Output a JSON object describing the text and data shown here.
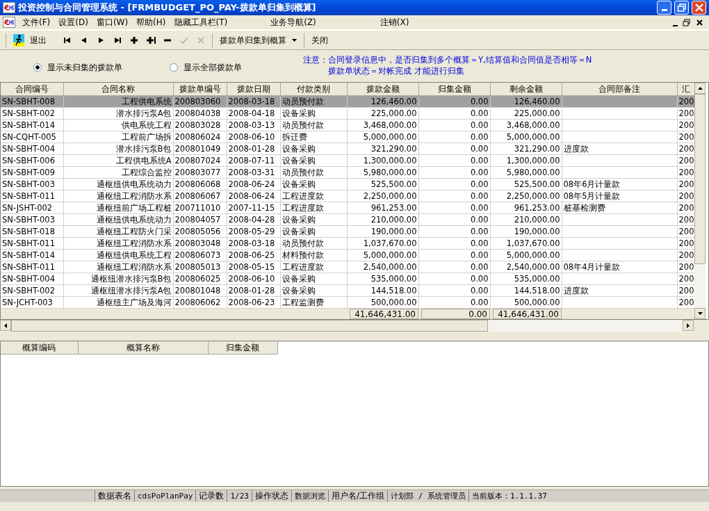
{
  "window": {
    "title": "投资控制与合同管理系统 - [FRMBUDGET_PO_PAY-拨款单归集到概算]"
  },
  "menu": [
    {
      "label": "文件(F)"
    },
    {
      "label": "设置(D)"
    },
    {
      "label": "窗口(W)"
    },
    {
      "label": "帮助(H)"
    },
    {
      "label": "隐藏工具栏(T)"
    },
    {
      "label": "业务导航(Z)"
    },
    {
      "label": "注销(X)"
    }
  ],
  "toolbar": [
    {
      "kind": "exit",
      "label": "退出"
    },
    {
      "kind": "first",
      "disabled": false
    },
    {
      "kind": "prev",
      "disabled": false
    },
    {
      "kind": "next",
      "disabled": false
    },
    {
      "kind": "last",
      "disabled": false
    },
    {
      "kind": "add",
      "disabled": false
    },
    {
      "kind": "insert",
      "disabled": false
    },
    {
      "kind": "delete",
      "disabled": false
    },
    {
      "kind": "confirm",
      "disabled": true
    },
    {
      "kind": "cancel",
      "disabled": true
    },
    {
      "kind": "dropdown",
      "label": "拨款单归集到概算"
    },
    {
      "kind": "button",
      "label": "关闭"
    }
  ],
  "filter": [
    {
      "label": "显示未归集的拨款单",
      "selected": true
    },
    {
      "label": "显示全部拨款单",
      "selected": false
    }
  ],
  "notice": [
    "注意：合同登录信息中，是否归集到多个概算＝Y,结算值和合同值是否相等＝N",
    "拨款单状态＝对帐完成 才能进行归集"
  ],
  "grid": {
    "columns": [
      "合同编号",
      "合同名称",
      "拨款单编号",
      "拨款日期",
      "付款类别",
      "拨款金额",
      "归集金额",
      "剩余金额",
      "合同部备注",
      "汇"
    ],
    "rows": [
      {
        "selected": true,
        "cells": [
          "SN-SBHT-008",
          "工程供电系统",
          "200803060",
          "2008-03-18",
          "动员预付款",
          "126,460.00",
          "0.00",
          "126,460.00",
          "",
          "200"
        ]
      },
      {
        "selected": false,
        "cells": [
          "SN-SBHT-002",
          "潜水排污泵A包",
          "200804038",
          "2008-04-18",
          "设备采购",
          "225,000.00",
          "0.00",
          "225,000.00",
          "",
          "200"
        ]
      },
      {
        "selected": false,
        "cells": [
          "SN-SBHT-014",
          "供电系统工程",
          "200803028",
          "2008-03-13",
          "动员预付款",
          "3,468,000.00",
          "0.00",
          "3,468,000.00",
          "",
          "200"
        ]
      },
      {
        "selected": false,
        "cells": [
          "SN-CQHT-005",
          "工程前广场拆",
          "200806024",
          "2008-06-10",
          "拆迁费",
          "5,000,000.00",
          "0.00",
          "5,000,000.00",
          "",
          "200"
        ]
      },
      {
        "selected": false,
        "cells": [
          "SN-SBHT-004",
          "潜水排污泵B包",
          "200801049",
          "2008-01-28",
          "设备采购",
          "321,290.00",
          "0.00",
          "321,290.00",
          "进度款",
          "200"
        ]
      },
      {
        "selected": false,
        "cells": [
          "SN-SBHT-006",
          "工程供电系统A",
          "200807024",
          "2008-07-11",
          "设备采购",
          "1,300,000.00",
          "0.00",
          "1,300,000.00",
          "",
          "200"
        ]
      },
      {
        "selected": false,
        "cells": [
          "SN-SBHT-009",
          "工程综合监控",
          "200803077",
          "2008-03-31",
          "动员预付款",
          "5,980,000.00",
          "0.00",
          "5,980,000.00",
          "",
          "200"
        ]
      },
      {
        "selected": false,
        "cells": [
          "SN-SBHT-003",
          "通枢纽供电系统动力",
          "200806068",
          "2008-06-24",
          "设备采购",
          "525,500.00",
          "0.00",
          "525,500.00",
          "08年6月计量款",
          "200"
        ]
      },
      {
        "selected": false,
        "cells": [
          "SN-SBHT-011",
          "通枢纽工程消防水系",
          "200806067",
          "2008-06-24",
          "工程进度款",
          "2,250,000.00",
          "0.00",
          "2,250,000.00",
          "08年5月计量款",
          "200"
        ]
      },
      {
        "selected": false,
        "cells": [
          "SN-JSHT-002",
          "通枢纽前广场工程桩",
          "200711010",
          "2007-11-15",
          "工程进度款",
          "961,253.00",
          "0.00",
          "961,253.00",
          "桩基检测费",
          "200"
        ]
      },
      {
        "selected": false,
        "cells": [
          "SN-SBHT-003",
          "通枢纽供电系统动力",
          "200804057",
          "2008-04-28",
          "设备采购",
          "210,000.00",
          "0.00",
          "210,000.00",
          "",
          "200"
        ]
      },
      {
        "selected": false,
        "cells": [
          "SN-SBHT-018",
          "通枢纽工程防火门采",
          "200805056",
          "2008-05-29",
          "设备采购",
          "190,000.00",
          "0.00",
          "190,000.00",
          "",
          "200"
        ]
      },
      {
        "selected": false,
        "cells": [
          "SN-SBHT-011",
          "通枢纽工程消防水系",
          "200803048",
          "2008-03-18",
          "动员预付款",
          "1,037,670.00",
          "0.00",
          "1,037,670.00",
          "",
          "200"
        ]
      },
      {
        "selected": false,
        "cells": [
          "SN-SBHT-014",
          "通枢纽供电系统工程",
          "200806073",
          "2008-06-25",
          "材料预付款",
          "5,000,000.00",
          "0.00",
          "5,000,000.00",
          "",
          "200"
        ]
      },
      {
        "selected": false,
        "cells": [
          "SN-SBHT-011",
          "通枢纽工程消防水系",
          "200805013",
          "2008-05-15",
          "工程进度款",
          "2,540,000.00",
          "0.00",
          "2,540,000.00",
          "08年4月计量款",
          "200"
        ]
      },
      {
        "selected": false,
        "cells": [
          "SN-SBHT-004",
          "通枢纽潜水排污泵B包",
          "200806025",
          "2008-06-10",
          "设备采购",
          "535,000.00",
          "0.00",
          "535,000.00",
          "",
          "200"
        ]
      },
      {
        "selected": false,
        "cells": [
          "SN-SBHT-002",
          "通枢纽潜水排污泵A包",
          "200801048",
          "2008-01-28",
          "设备采购",
          "144,518.00",
          "0.00",
          "144,518.00",
          "进度款",
          "200"
        ]
      },
      {
        "selected": false,
        "cells": [
          "SN-JCHT-003",
          "通枢纽主广场及海河",
          "200806062",
          "2008-06-23",
          "工程监测费",
          "500,000.00",
          "0.00",
          "500,000.00",
          "",
          "200"
        ]
      }
    ],
    "totals": [
      "41,646,431.00",
      "0.00",
      "41,646,431.00"
    ]
  },
  "budget_grid": {
    "columns": [
      "概算编码",
      "概算名称",
      "归集金额"
    ]
  },
  "status_bar": [
    {
      "kind": "label",
      "text": "数据表名"
    },
    {
      "kind": "value",
      "text": "cdsPoPlanPay"
    },
    {
      "kind": "label",
      "text": "记录数"
    },
    {
      "kind": "value",
      "text": "1/23"
    },
    {
      "kind": "label",
      "text": "操作状态"
    },
    {
      "kind": "value",
      "text": "数据浏览"
    },
    {
      "kind": "label",
      "text": "用户名/工作组"
    },
    {
      "kind": "value",
      "text": "计划部 / 系统管理员"
    },
    {
      "kind": "value",
      "text": "当前版本：1.1.1.37"
    }
  ]
}
